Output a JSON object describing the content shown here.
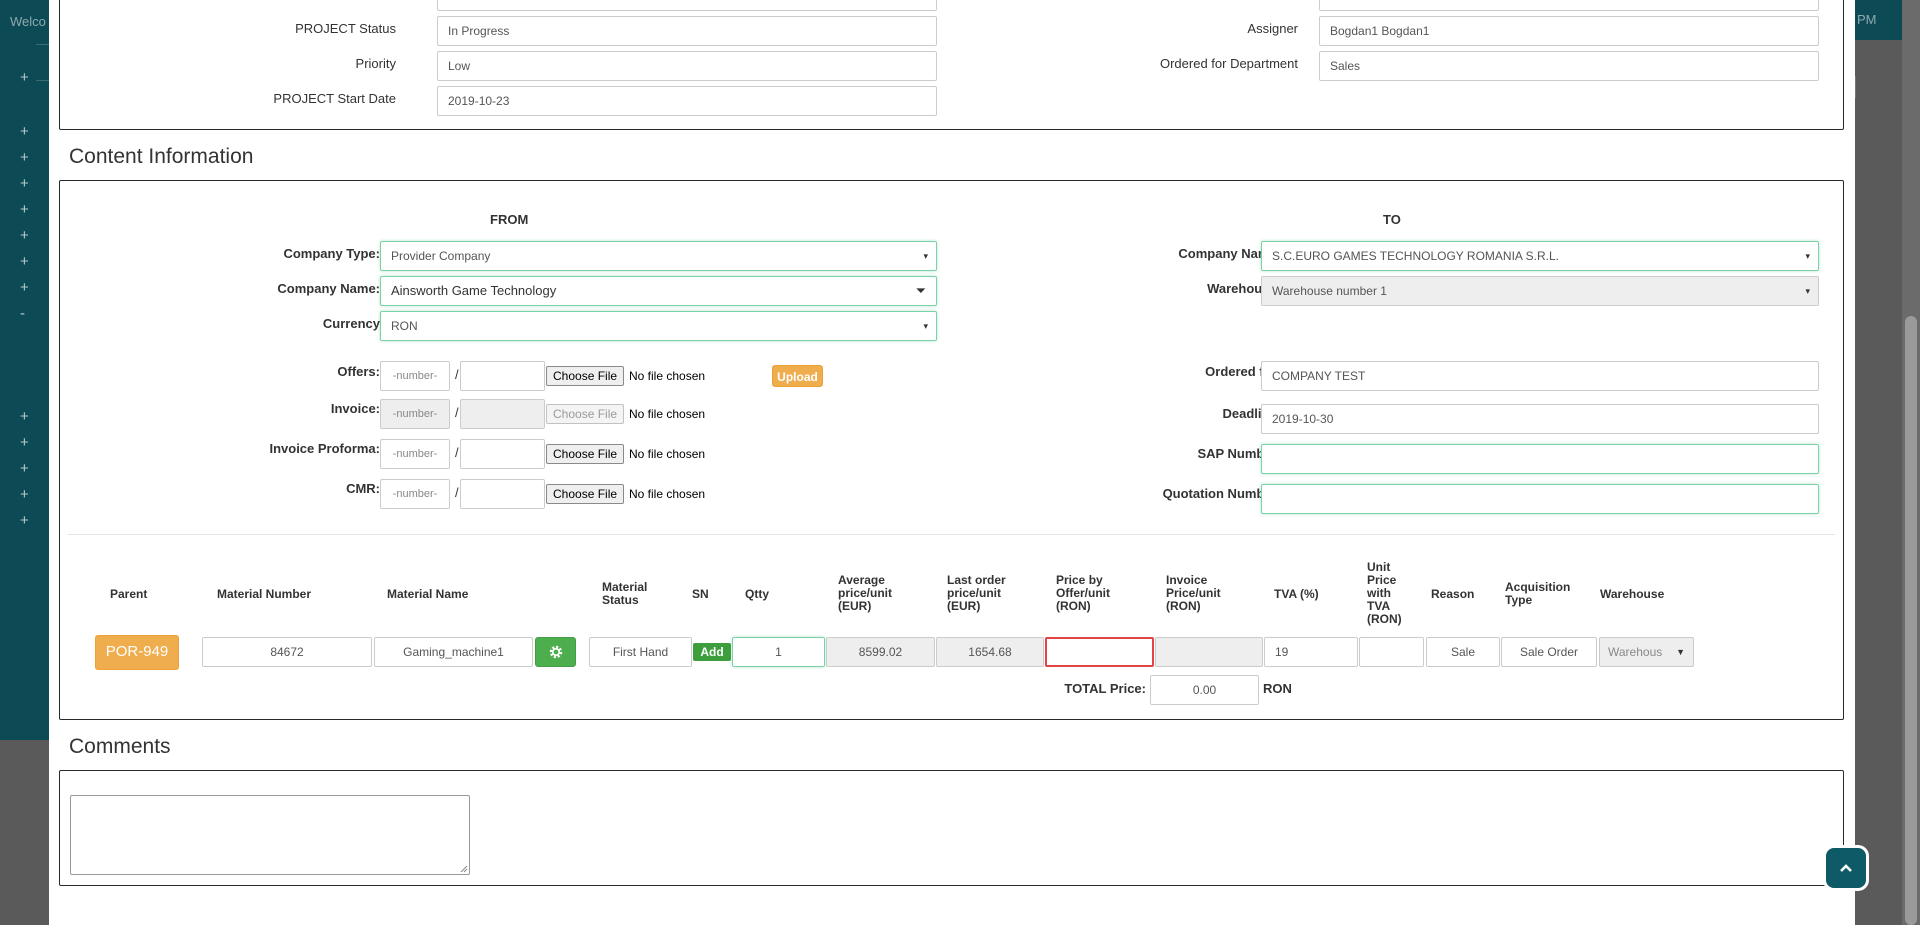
{
  "background": {
    "welcome_text": "Welco",
    "topbar_time": "PM"
  },
  "project": {
    "status_label": "PROJECT Status",
    "status_value": "In Progress",
    "priority_label": "Priority",
    "priority_value": "Low",
    "start_date_label": "PROJECT Start Date",
    "start_date_value": "2019-10-23",
    "assigner_label": "Assigner",
    "assigner_value": "Bogdan1 Bogdan1",
    "ordered_dept_label": "Ordered for Department",
    "ordered_dept_value": "Sales"
  },
  "content": {
    "title": "Content Information",
    "from_header": "FROM",
    "to_header": "TO",
    "from": {
      "company_type_label": "Company Type:",
      "company_type_value": "Provider Company",
      "company_name_label": "Company Name:",
      "company_name_value": "Ainsworth Game Technology",
      "currency_label": "Currency",
      "currency_value": "RON"
    },
    "to": {
      "company_name_label": "Company Name:",
      "company_name_value": "S.C.EURO GAMES TECHNOLOGY ROMANIA S.R.L.",
      "warehouse_label": "Warehouse:",
      "warehouse_value": "Warehouse number 1",
      "ordered_for_label": "Ordered for:",
      "ordered_for_value": "COMPANY TEST",
      "deadline_label": "Deadline:",
      "deadline_value": "2019-10-30",
      "sap_label": "SAP Number:",
      "sap_value": "",
      "quotation_label": "Quotation Number:",
      "quotation_value": ""
    },
    "documents": {
      "number_placeholder": "-number-",
      "slash": "/",
      "choose_file": "Choose File",
      "no_file": "No file chosen",
      "upload": "Upload",
      "offers_label": "Offers:",
      "invoice_label": "Invoice:",
      "proforma_label": "Invoice Proforma:",
      "cmr_label": "CMR:"
    }
  },
  "materials": {
    "headers": {
      "parent": "Parent",
      "material_number": "Material Number",
      "material_name": "Material Name",
      "material_status": "Material Status",
      "sn": "SN",
      "qtty": "Qtty",
      "avg_price": "Average price/unit (EUR)",
      "last_order_price": "Last order price/unit (EUR)",
      "price_offer": "Price by Offer/unit (RON)",
      "invoice_price": "Invoice Price/unit (RON)",
      "tva": "TVA (%)",
      "unit_price_tva": "Unit Price with TVA (RON)",
      "reason": "Reason",
      "acquisition_type": "Acquisition Type",
      "warehouse": "Warehouse"
    },
    "row": {
      "parent": "POR-949",
      "material_number": "84672",
      "material_name": "Gaming_machine1",
      "material_status": "First Hand",
      "sn_button": "Add",
      "qtty": "1",
      "avg_price": "8599.02",
      "last_order_price": "1654.68",
      "price_offer": "",
      "invoice_price": "",
      "tva": "19",
      "unit_price_tva": "",
      "reason": "Sale",
      "acquisition_type": "Sale Order",
      "warehouse": "Warehous"
    },
    "total_label": "TOTAL Price:",
    "total_value": "0.00",
    "total_currency": "RON"
  },
  "comments": {
    "title": "Comments",
    "value": ""
  },
  "icons": {
    "caret": "▾",
    "gear": "gear-icon",
    "scroll_top": "chevron-up-icon"
  }
}
